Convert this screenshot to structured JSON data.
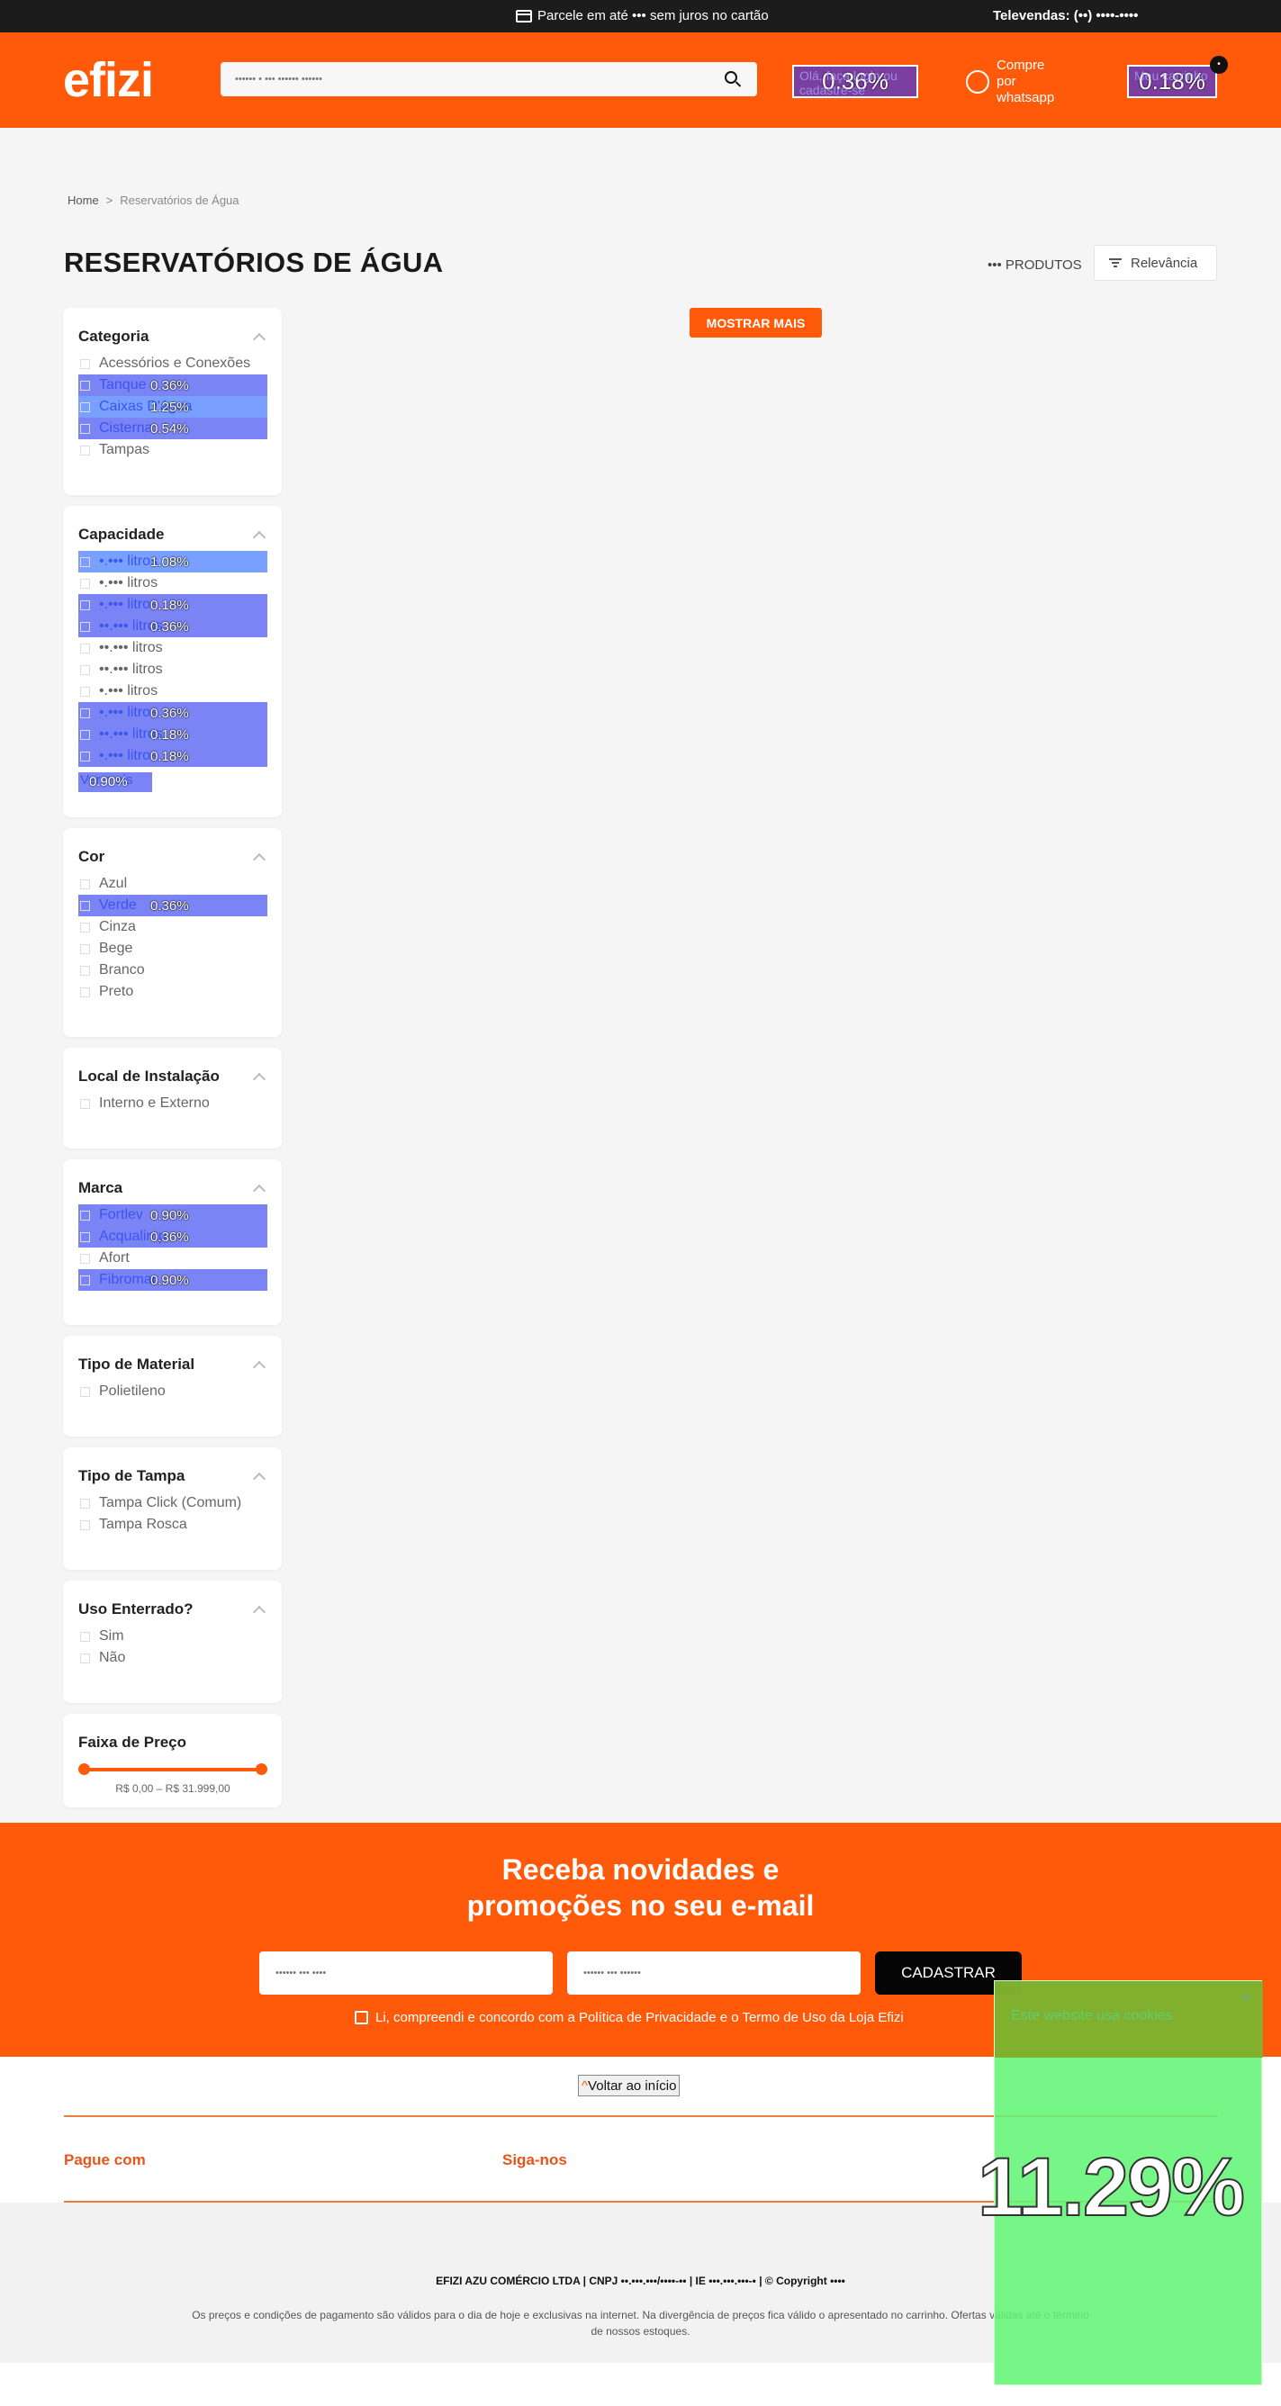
{
  "topbar": {
    "promo": "Parcele em até ••• sem juros no cartão",
    "televendas": "Televendas: (••) ••••-••••"
  },
  "header": {
    "logo": "efizi",
    "search_placeholder": "•••••• • ••• •••••• ••••••",
    "login_label": "Olá, faça login ou cadastre-se",
    "login_heat": "0.36%",
    "whatsapp": [
      "Compre",
      "por",
      "whatsapp"
    ],
    "cart_label": "Meu carrinho",
    "cart_heat": "0.18%",
    "cart_count": "•"
  },
  "breadcrumb": {
    "home": "Home",
    "sep": ">",
    "current": "Reservatórios de Água"
  },
  "page": {
    "title": "RESERVATÓRIOS DE ÁGUA",
    "count": "••• PRODUTOS",
    "sort": "Relevância",
    "show_more": "MOSTRAR MAIS"
  },
  "filters": [
    {
      "title": "Categoria",
      "items": [
        {
          "label": "Acessórios e Conexões"
        },
        {
          "label": "Tanque",
          "heat": "0.36%"
        },
        {
          "label": "Caixas D'água",
          "heat": "1.25%"
        },
        {
          "label": "Cisterna",
          "heat": "0.54%"
        },
        {
          "label": "Tampas"
        }
      ]
    },
    {
      "title": "Capacidade",
      "items": [
        {
          "label": "•.••• litros",
          "heat": "1.08%"
        },
        {
          "label": "•.••• litros"
        },
        {
          "label": "•.••• litros",
          "heat": "0.18%"
        },
        {
          "label": "••.••• litros",
          "heat": "0.36%"
        },
        {
          "label": "••.••• litros"
        },
        {
          "label": "••.••• litros"
        },
        {
          "label": "•.••• litros"
        },
        {
          "label": "•.••• litros",
          "heat": "0.36%"
        },
        {
          "label": "••.••• litros",
          "heat": "0.18%"
        },
        {
          "label": "•.••• litros",
          "heat": "0.18%"
        }
      ],
      "more": "Ver mais",
      "more_heat": "0.90%"
    },
    {
      "title": "Cor",
      "items": [
        {
          "label": "Azul"
        },
        {
          "label": "Verde",
          "heat": "0.36%"
        },
        {
          "label": "Cinza"
        },
        {
          "label": "Bege"
        },
        {
          "label": "Branco"
        },
        {
          "label": "Preto"
        }
      ]
    },
    {
      "title": "Local de Instalação",
      "items": [
        {
          "label": "Interno e Externo"
        }
      ]
    },
    {
      "title": "Marca",
      "items": [
        {
          "label": "Fortlev",
          "heat": "0.90%"
        },
        {
          "label": "Acqualimp",
          "heat": "0.36%"
        },
        {
          "label": "Afort"
        },
        {
          "label": "Fibromar",
          "heat": "0.90%"
        }
      ]
    },
    {
      "title": "Tipo de Material",
      "items": [
        {
          "label": "Polietileno"
        }
      ]
    },
    {
      "title": "Tipo de Tampa",
      "items": [
        {
          "label": "Tampa Click (Comum)"
        },
        {
          "label": "Tampa Rosca"
        }
      ]
    },
    {
      "title": "Uso Enterrado?",
      "items": [
        {
          "label": "Sim"
        },
        {
          "label": "Não"
        }
      ]
    }
  ],
  "price": {
    "title": "Faixa de Preço",
    "range": "R$ 0,00 – R$ 31.999,00",
    "min": 0,
    "max": 31999
  },
  "newsletter": {
    "title_1": "Receba novidades e",
    "title_2": "promoções no seu e-mail",
    "name_placeholder": "•••••• ••• ••••",
    "email_placeholder": "•••••• ••• ••••••",
    "submit": "CADASTRAR",
    "consent": "Li, compreendi e concordo com a Política de Privacidade e o Termo de Uso da Loja Efizi"
  },
  "back_to_top": "Voltar ao início",
  "footer": {
    "pay": "Pague com",
    "follow": "Siga-nos",
    "company": "EFIZI AZU COMÉRCIO LTDA | CNPJ ••.•••.•••/••••-•• | IE •••.•••.•••-• | © Copyright ••••",
    "disclaimer": "Os preços e condições de pagamento são válidos para o dia de hoje e exclusivas na internet. Na divergência de preços fica válido o apresentado no carrinho. Ofertas válidas até o término de nossos estoques."
  },
  "cookie": {
    "title": "Este website usa cookies",
    "heat": "11.29%"
  },
  "colors": {
    "brand": "#ff5a0a",
    "topbar": "#1c1c1c",
    "heat_overlay": "#7b84f5",
    "cookie_overlay": "#64f578"
  }
}
